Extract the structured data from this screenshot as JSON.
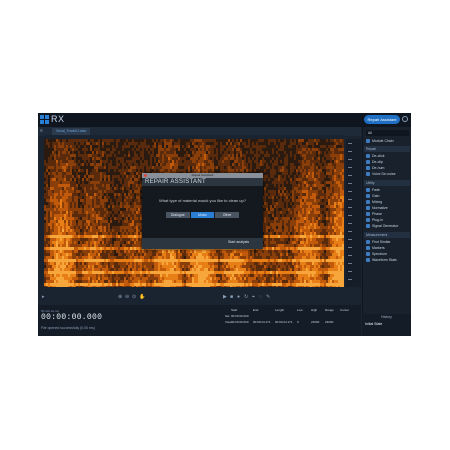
{
  "app": {
    "logo": "RX",
    "repair_assistant_btn": "Repair Assistant",
    "file_tab": "Vocal_Track01.wav"
  },
  "dialog": {
    "window_title": "Repair Assistant",
    "header": "REPAIR ASSISTANT",
    "question": "What type of material would you like to clean up?",
    "options": [
      "Dialogue",
      "Music",
      "Other"
    ],
    "selected_index": 1,
    "start_label": "Start analysis"
  },
  "right_panel": {
    "search": "All",
    "module_chain": "Module Chain",
    "repair_header": "Repair",
    "repair_items": [
      "De-click",
      "De-clip",
      "De-hum",
      "Voice De-noise"
    ],
    "utility_header": "Utility",
    "utility_items": [
      "Fade",
      "Gain",
      "Mixing",
      "Normalize",
      "Phase",
      "Plug-in",
      "Signal Generator"
    ],
    "measurement_header": "Measurement",
    "measurement_items": [
      "Find Similar",
      "Markers",
      "Spectrum",
      "Waveform Stats"
    ]
  },
  "history": {
    "title": "History",
    "item": "Initial State"
  },
  "bottom": {
    "tc_label": "hh:mm:ss.ms",
    "timecode": "00:00:00.000",
    "status": "File opened successfully (0.00 ms)",
    "sel_headers": [
      "Start",
      "End",
      "Length",
      "Low",
      "High",
      "Range",
      "Cursor"
    ],
    "sel_row_label": "Sel",
    "view_row_label": "View",
    "sel_values": [
      "00:00:00.000",
      "",
      "",
      "",
      "",
      "",
      ""
    ],
    "view_values": [
      "00:00:00.000",
      "00:00:24.171",
      "00:00:24.171",
      "0",
      "24000",
      "24000",
      ""
    ]
  }
}
